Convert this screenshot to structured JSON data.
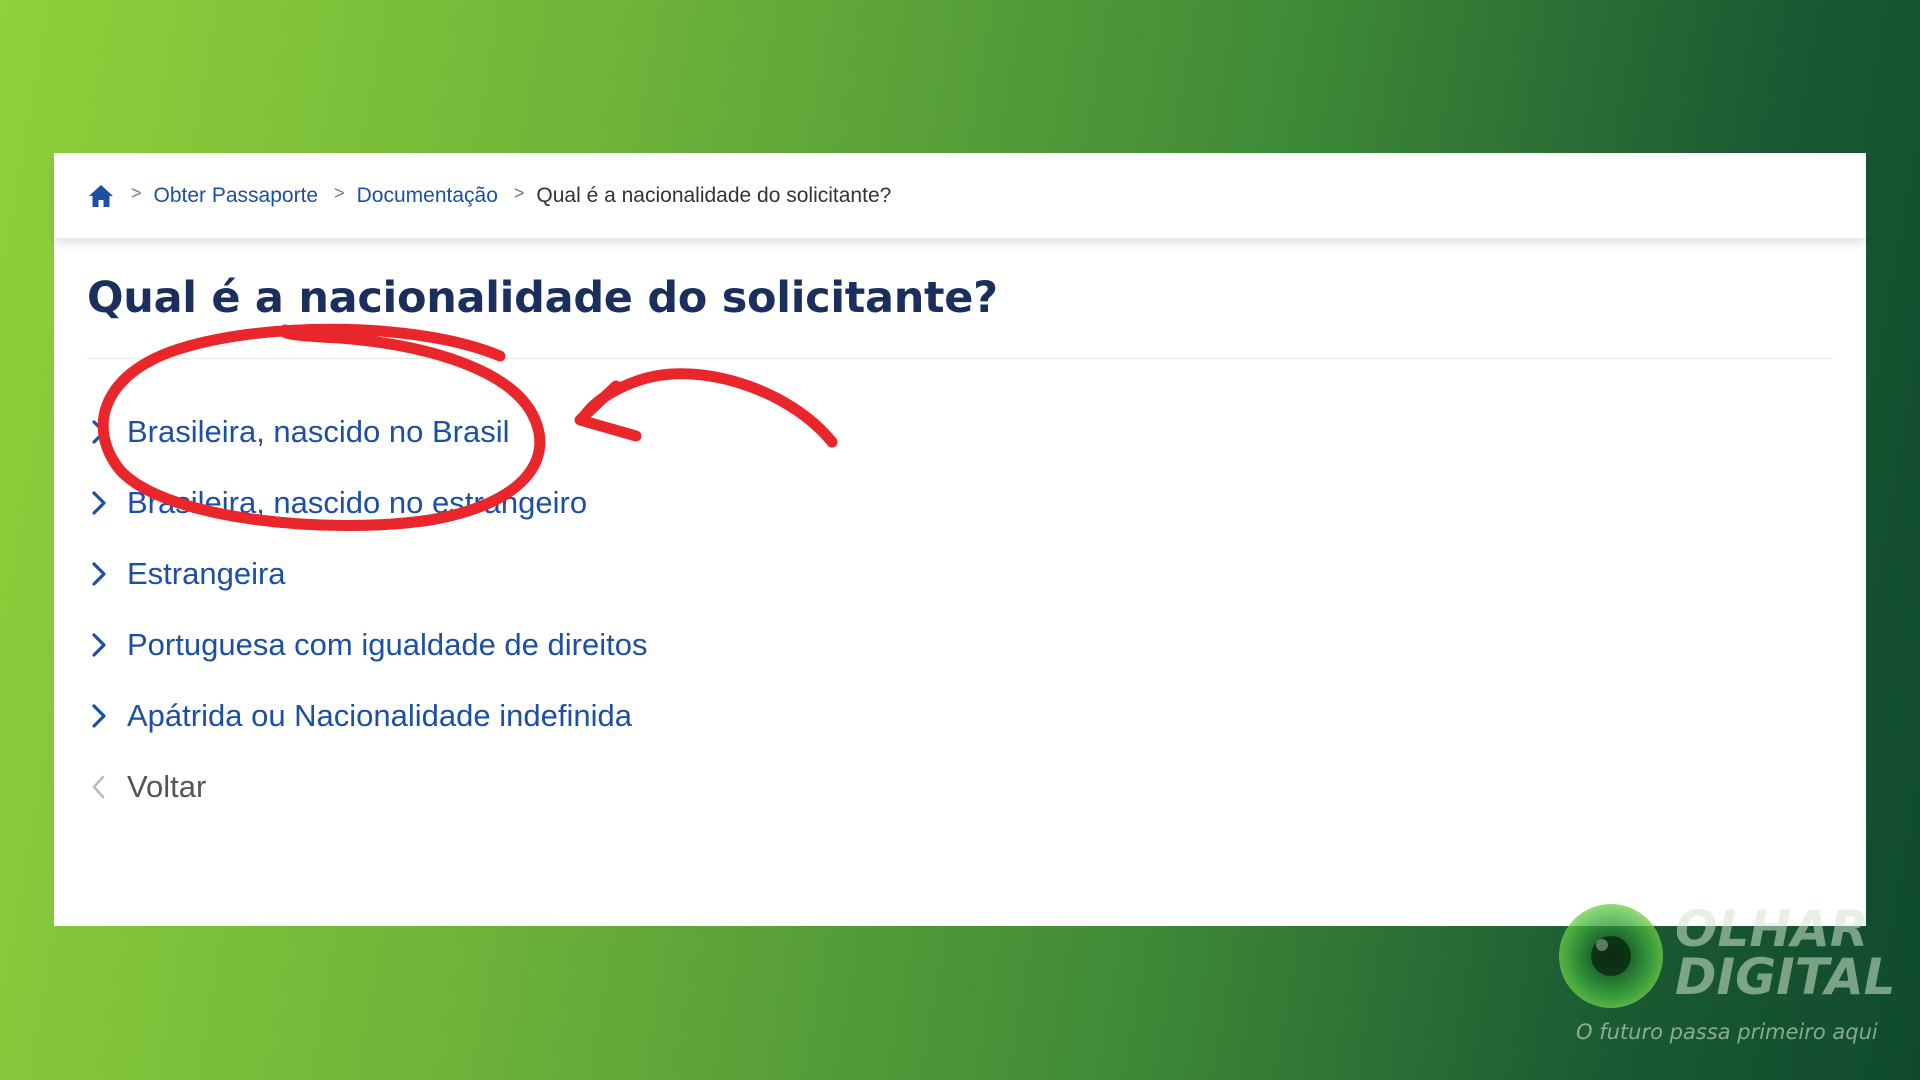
{
  "breadcrumb": {
    "home_icon": "home-icon",
    "items": [
      {
        "label": "Obter Passaporte"
      },
      {
        "label": "Documentação"
      },
      {
        "label": "Qual é a nacionalidade do solicitante?"
      }
    ],
    "separator": ">"
  },
  "page": {
    "title": "Qual é a nacionalidade do solicitante?"
  },
  "options": [
    {
      "label": "Brasileira, nascido no Brasil"
    },
    {
      "label": "Brasileira, nascido no estrangeiro"
    },
    {
      "label": "Estrangeira"
    },
    {
      "label": "Portuguesa com igualdade de direitos"
    },
    {
      "label": "Apátrida ou Nacionalidade indefinida"
    }
  ],
  "back": {
    "label": "Voltar"
  },
  "annotation": {
    "color": "#e8262b",
    "shapes": [
      "circle-mark",
      "arrow-mark"
    ]
  },
  "watermark": {
    "brand": "OLHAR\nDIGITAL",
    "tagline": "O futuro passa primeiro aqui"
  },
  "colors": {
    "link": "#1d4fa3",
    "title": "#1a2f5c",
    "background_start": "#8fd13a",
    "background_end": "#0f4a2e"
  }
}
